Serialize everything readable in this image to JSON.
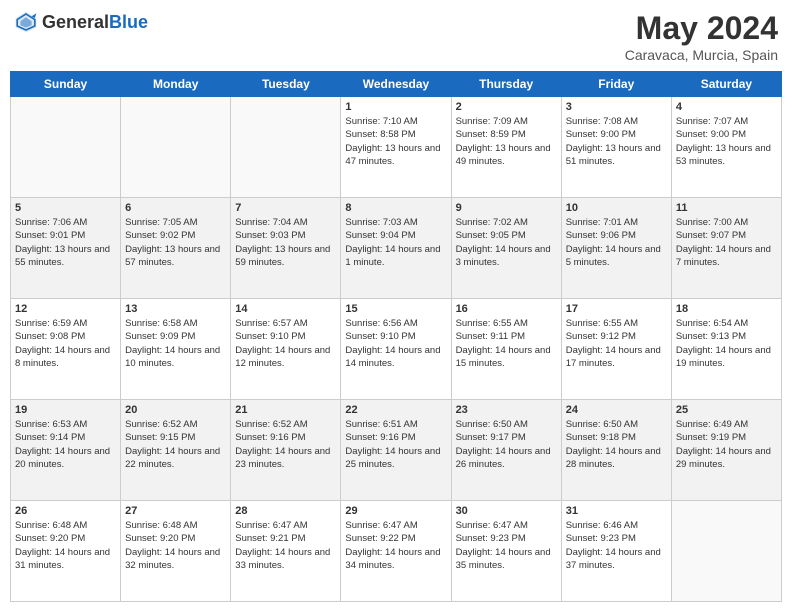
{
  "header": {
    "logo_general": "General",
    "logo_blue": "Blue",
    "month_year": "May 2024",
    "location": "Caravaca, Murcia, Spain"
  },
  "days_of_week": [
    "Sunday",
    "Monday",
    "Tuesday",
    "Wednesday",
    "Thursday",
    "Friday",
    "Saturday"
  ],
  "weeks": [
    [
      {
        "day": "",
        "sunrise": "",
        "sunset": "",
        "daylight": ""
      },
      {
        "day": "",
        "sunrise": "",
        "sunset": "",
        "daylight": ""
      },
      {
        "day": "",
        "sunrise": "",
        "sunset": "",
        "daylight": ""
      },
      {
        "day": "1",
        "sunrise": "Sunrise: 7:10 AM",
        "sunset": "Sunset: 8:58 PM",
        "daylight": "Daylight: 13 hours and 47 minutes."
      },
      {
        "day": "2",
        "sunrise": "Sunrise: 7:09 AM",
        "sunset": "Sunset: 8:59 PM",
        "daylight": "Daylight: 13 hours and 49 minutes."
      },
      {
        "day": "3",
        "sunrise": "Sunrise: 7:08 AM",
        "sunset": "Sunset: 9:00 PM",
        "daylight": "Daylight: 13 hours and 51 minutes."
      },
      {
        "day": "4",
        "sunrise": "Sunrise: 7:07 AM",
        "sunset": "Sunset: 9:00 PM",
        "daylight": "Daylight: 13 hours and 53 minutes."
      }
    ],
    [
      {
        "day": "5",
        "sunrise": "Sunrise: 7:06 AM",
        "sunset": "Sunset: 9:01 PM",
        "daylight": "Daylight: 13 hours and 55 minutes."
      },
      {
        "day": "6",
        "sunrise": "Sunrise: 7:05 AM",
        "sunset": "Sunset: 9:02 PM",
        "daylight": "Daylight: 13 hours and 57 minutes."
      },
      {
        "day": "7",
        "sunrise": "Sunrise: 7:04 AM",
        "sunset": "Sunset: 9:03 PM",
        "daylight": "Daylight: 13 hours and 59 minutes."
      },
      {
        "day": "8",
        "sunrise": "Sunrise: 7:03 AM",
        "sunset": "Sunset: 9:04 PM",
        "daylight": "Daylight: 14 hours and 1 minute."
      },
      {
        "day": "9",
        "sunrise": "Sunrise: 7:02 AM",
        "sunset": "Sunset: 9:05 PM",
        "daylight": "Daylight: 14 hours and 3 minutes."
      },
      {
        "day": "10",
        "sunrise": "Sunrise: 7:01 AM",
        "sunset": "Sunset: 9:06 PM",
        "daylight": "Daylight: 14 hours and 5 minutes."
      },
      {
        "day": "11",
        "sunrise": "Sunrise: 7:00 AM",
        "sunset": "Sunset: 9:07 PM",
        "daylight": "Daylight: 14 hours and 7 minutes."
      }
    ],
    [
      {
        "day": "12",
        "sunrise": "Sunrise: 6:59 AM",
        "sunset": "Sunset: 9:08 PM",
        "daylight": "Daylight: 14 hours and 8 minutes."
      },
      {
        "day": "13",
        "sunrise": "Sunrise: 6:58 AM",
        "sunset": "Sunset: 9:09 PM",
        "daylight": "Daylight: 14 hours and 10 minutes."
      },
      {
        "day": "14",
        "sunrise": "Sunrise: 6:57 AM",
        "sunset": "Sunset: 9:10 PM",
        "daylight": "Daylight: 14 hours and 12 minutes."
      },
      {
        "day": "15",
        "sunrise": "Sunrise: 6:56 AM",
        "sunset": "Sunset: 9:10 PM",
        "daylight": "Daylight: 14 hours and 14 minutes."
      },
      {
        "day": "16",
        "sunrise": "Sunrise: 6:55 AM",
        "sunset": "Sunset: 9:11 PM",
        "daylight": "Daylight: 14 hours and 15 minutes."
      },
      {
        "day": "17",
        "sunrise": "Sunrise: 6:55 AM",
        "sunset": "Sunset: 9:12 PM",
        "daylight": "Daylight: 14 hours and 17 minutes."
      },
      {
        "day": "18",
        "sunrise": "Sunrise: 6:54 AM",
        "sunset": "Sunset: 9:13 PM",
        "daylight": "Daylight: 14 hours and 19 minutes."
      }
    ],
    [
      {
        "day": "19",
        "sunrise": "Sunrise: 6:53 AM",
        "sunset": "Sunset: 9:14 PM",
        "daylight": "Daylight: 14 hours and 20 minutes."
      },
      {
        "day": "20",
        "sunrise": "Sunrise: 6:52 AM",
        "sunset": "Sunset: 9:15 PM",
        "daylight": "Daylight: 14 hours and 22 minutes."
      },
      {
        "day": "21",
        "sunrise": "Sunrise: 6:52 AM",
        "sunset": "Sunset: 9:16 PM",
        "daylight": "Daylight: 14 hours and 23 minutes."
      },
      {
        "day": "22",
        "sunrise": "Sunrise: 6:51 AM",
        "sunset": "Sunset: 9:16 PM",
        "daylight": "Daylight: 14 hours and 25 minutes."
      },
      {
        "day": "23",
        "sunrise": "Sunrise: 6:50 AM",
        "sunset": "Sunset: 9:17 PM",
        "daylight": "Daylight: 14 hours and 26 minutes."
      },
      {
        "day": "24",
        "sunrise": "Sunrise: 6:50 AM",
        "sunset": "Sunset: 9:18 PM",
        "daylight": "Daylight: 14 hours and 28 minutes."
      },
      {
        "day": "25",
        "sunrise": "Sunrise: 6:49 AM",
        "sunset": "Sunset: 9:19 PM",
        "daylight": "Daylight: 14 hours and 29 minutes."
      }
    ],
    [
      {
        "day": "26",
        "sunrise": "Sunrise: 6:48 AM",
        "sunset": "Sunset: 9:20 PM",
        "daylight": "Daylight: 14 hours and 31 minutes."
      },
      {
        "day": "27",
        "sunrise": "Sunrise: 6:48 AM",
        "sunset": "Sunset: 9:20 PM",
        "daylight": "Daylight: 14 hours and 32 minutes."
      },
      {
        "day": "28",
        "sunrise": "Sunrise: 6:47 AM",
        "sunset": "Sunset: 9:21 PM",
        "daylight": "Daylight: 14 hours and 33 minutes."
      },
      {
        "day": "29",
        "sunrise": "Sunrise: 6:47 AM",
        "sunset": "Sunset: 9:22 PM",
        "daylight": "Daylight: 14 hours and 34 minutes."
      },
      {
        "day": "30",
        "sunrise": "Sunrise: 6:47 AM",
        "sunset": "Sunset: 9:23 PM",
        "daylight": "Daylight: 14 hours and 35 minutes."
      },
      {
        "day": "31",
        "sunrise": "Sunrise: 6:46 AM",
        "sunset": "Sunset: 9:23 PM",
        "daylight": "Daylight: 14 hours and 37 minutes."
      },
      {
        "day": "",
        "sunrise": "",
        "sunset": "",
        "daylight": ""
      }
    ]
  ]
}
